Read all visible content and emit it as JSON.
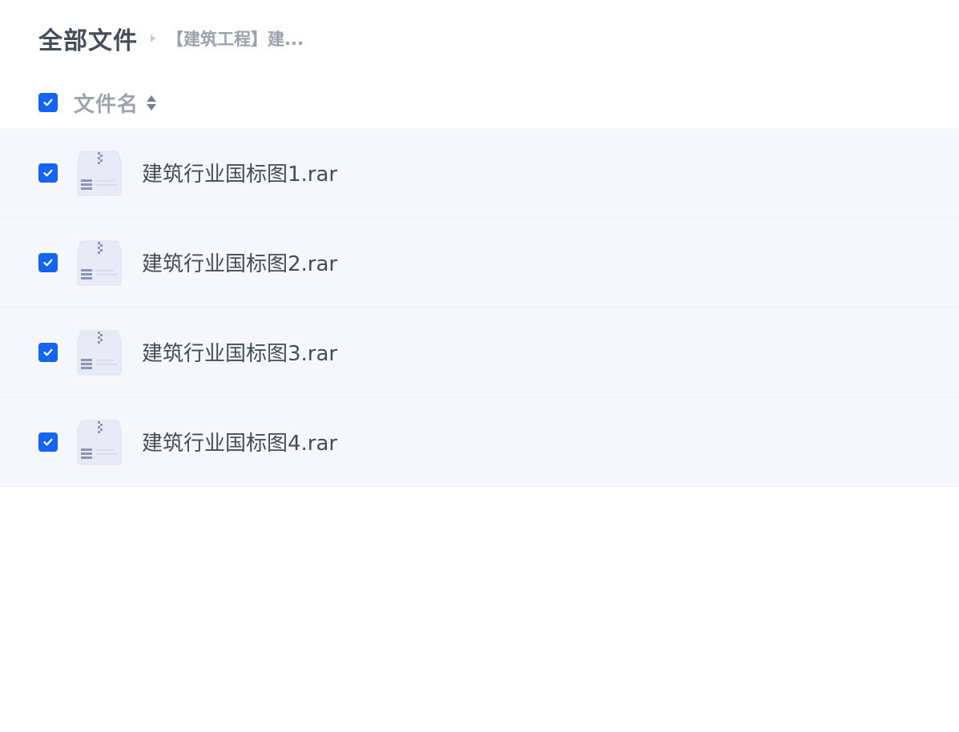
{
  "breadcrumb": {
    "root": "全部文件",
    "current": "【建筑工程】建..."
  },
  "table": {
    "header": {
      "checked": true,
      "column_label": "文件名",
      "sort_icon": "sort-icon"
    },
    "rows": [
      {
        "name": "建筑行业国标图1.rar",
        "checked": true,
        "icon": "archive-file-icon"
      },
      {
        "name": "建筑行业国标图2.rar",
        "checked": true,
        "icon": "archive-file-icon"
      },
      {
        "name": "建筑行业国标图3.rar",
        "checked": true,
        "icon": "archive-file-icon"
      },
      {
        "name": "建筑行业国标图4.rar",
        "checked": true,
        "icon": "archive-file-icon"
      }
    ]
  },
  "colors": {
    "accent": "#1465f4",
    "row_background": "#f5f7fd",
    "text": "#454d5a",
    "muted_text": "#9ea3ad"
  }
}
